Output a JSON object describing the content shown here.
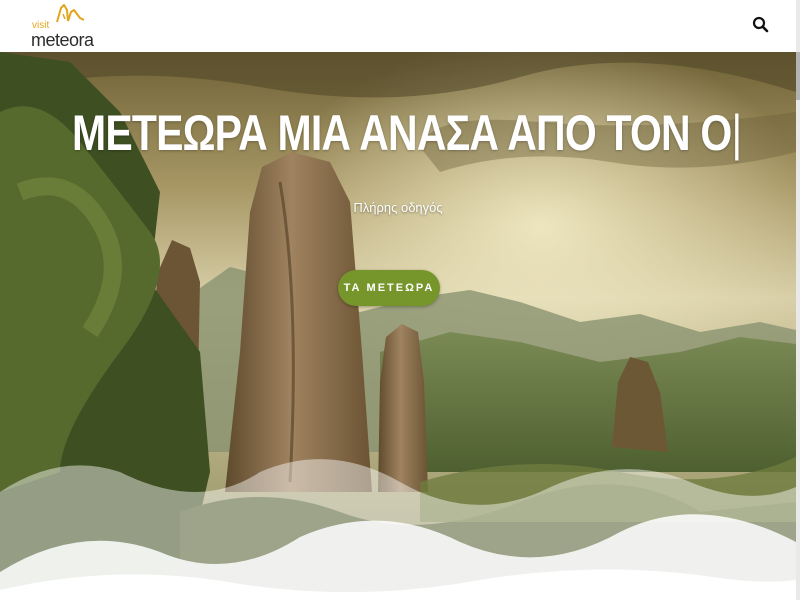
{
  "header": {
    "logo_small": "visit",
    "logo_big": "meteora",
    "search_icon": "search-icon"
  },
  "hero": {
    "title": "ΜΕΤΕΩΡΑ ΜΙΑ ΑΝΑΣΑ ΑΠΟ ΤΟΝ Ο",
    "cursor": "|",
    "subtitle": "Πλήρης οδηγός",
    "cta_label": "ΤΑ ΜΕΤΕΩΡΑ"
  },
  "colors": {
    "cta_background": "#76952a",
    "logo_accent": "#e3a51c",
    "header_background": "#ffffff"
  }
}
